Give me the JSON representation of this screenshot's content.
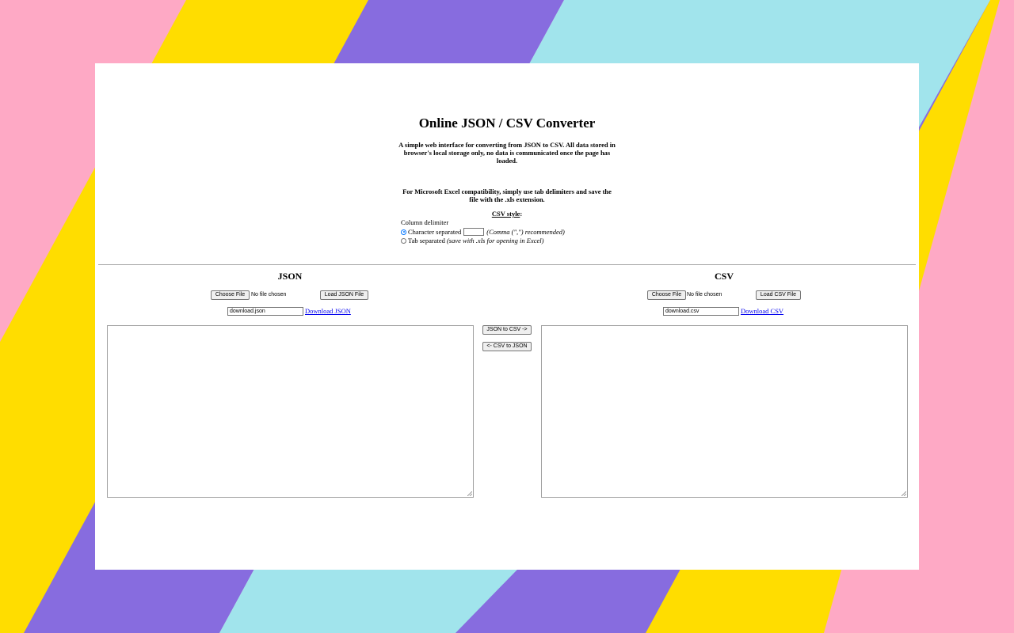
{
  "page": {
    "title": "Online JSON / CSV Converter",
    "description": "A simple web interface for converting from JSON to CSV. All data stored in browser's local storage only, no data is communicated once the page has loaded.",
    "excel_note": "For Microsoft Excel compatibility, simply use tab delimiters and save the file with the .xls extension."
  },
  "csv_style": {
    "heading": "CSV style",
    "heading_suffix": ":",
    "column_delimiter_label": "Column delimiter",
    "character_separated_label": "Character separated",
    "character_value": "",
    "character_hint": "(Comma (\",\") recommended)",
    "tab_separated_label": "Tab separated",
    "tab_hint": "(save with .xls for opening in Excel)",
    "selected": "character"
  },
  "json_panel": {
    "title": "JSON",
    "choose_file_label": "Choose File",
    "no_file_text": "No file chosen",
    "load_button": "Load JSON File",
    "filename": "download.json",
    "download_link": "Download JSON",
    "content": ""
  },
  "csv_panel": {
    "title": "CSV",
    "choose_file_label": "Choose File",
    "no_file_text": "No file chosen",
    "load_button": "Load CSV File",
    "filename": "download.csv",
    "download_link": "Download CSV",
    "content": ""
  },
  "actions": {
    "json_to_csv": "JSON to CSV ->",
    "csv_to_json": "<- CSV to JSON"
  },
  "colors": {
    "background_pink": "#fea9c5",
    "stripe_yellow": "#ffdd00",
    "stripe_purple": "#876cdf",
    "stripe_cyan": "#a1e4ec",
    "link": "#0000ee"
  }
}
